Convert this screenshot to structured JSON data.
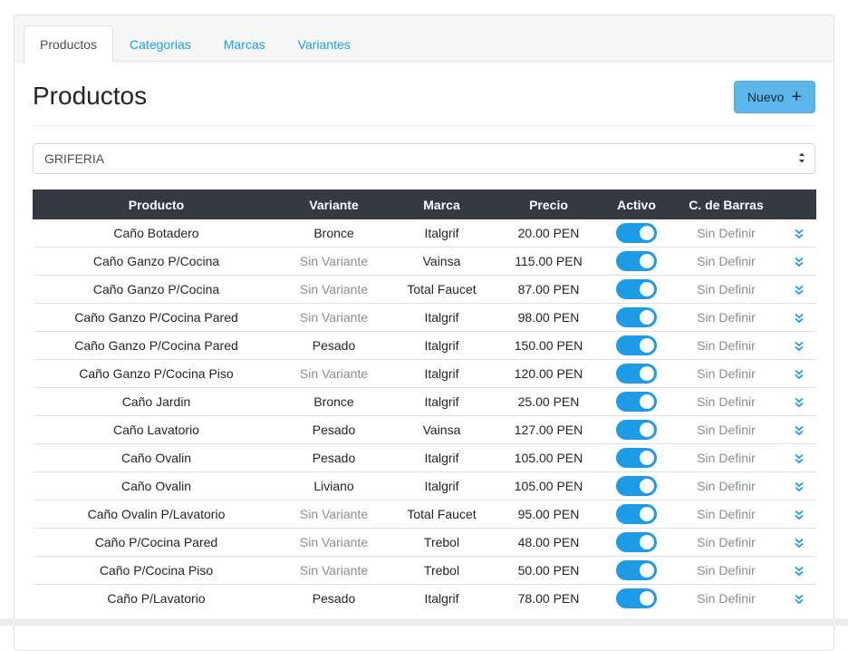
{
  "tabs": [
    {
      "label": "Productos",
      "active": true
    },
    {
      "label": "Categorias",
      "active": false
    },
    {
      "label": "Marcas",
      "active": false
    },
    {
      "label": "Variantes",
      "active": false
    }
  ],
  "page_title": "Productos",
  "new_button": {
    "label": "Nuevo",
    "icon": "plus-icon"
  },
  "category_select": {
    "value": "GRIFERIA"
  },
  "table": {
    "headers": [
      "Producto",
      "Variante",
      "Marca",
      "Precio",
      "Activo",
      "C. de Barras",
      ""
    ],
    "rows": [
      {
        "producto": "Caño Botadero",
        "variante": "Bronce",
        "variante_muted": false,
        "marca": "Italgrif",
        "precio": "20.00 PEN",
        "activo": true,
        "barras": "Sin Definir"
      },
      {
        "producto": "Caño Ganzo P/Cocina",
        "variante": "Sin Variante",
        "variante_muted": true,
        "marca": "Vainsa",
        "precio": "115.00 PEN",
        "activo": true,
        "barras": "Sin Definir"
      },
      {
        "producto": "Caño Ganzo P/Cocina",
        "variante": "Sin Variante",
        "variante_muted": true,
        "marca": "Total Faucet",
        "precio": "87.00 PEN",
        "activo": true,
        "barras": "Sin Definir"
      },
      {
        "producto": "Caño Ganzo P/Cocina Pared",
        "variante": "Sin Variante",
        "variante_muted": true,
        "marca": "Italgrif",
        "precio": "98.00 PEN",
        "activo": true,
        "barras": "Sin Definir"
      },
      {
        "producto": "Caño Ganzo P/Cocina Pared",
        "variante": "Pesado",
        "variante_muted": false,
        "marca": "Italgrif",
        "precio": "150.00 PEN",
        "activo": true,
        "barras": "Sin Definir"
      },
      {
        "producto": "Caño Ganzo P/Cocina Piso",
        "variante": "Sin Variante",
        "variante_muted": true,
        "marca": "Italgrif",
        "precio": "120.00 PEN",
        "activo": true,
        "barras": "Sin Definir"
      },
      {
        "producto": "Caño Jardin",
        "variante": "Bronce",
        "variante_muted": false,
        "marca": "Italgrif",
        "precio": "25.00 PEN",
        "activo": true,
        "barras": "Sin Definir"
      },
      {
        "producto": "Caño Lavatorio",
        "variante": "Pesado",
        "variante_muted": false,
        "marca": "Vainsa",
        "precio": "127.00 PEN",
        "activo": true,
        "barras": "Sin Definir"
      },
      {
        "producto": "Caño Ovalin",
        "variante": "Pesado",
        "variante_muted": false,
        "marca": "Italgrif",
        "precio": "105.00 PEN",
        "activo": true,
        "barras": "Sin Definir"
      },
      {
        "producto": "Caño Ovalin",
        "variante": "Liviano",
        "variante_muted": false,
        "marca": "Italgrif",
        "precio": "105.00 PEN",
        "activo": true,
        "barras": "Sin Definir"
      },
      {
        "producto": "Caño Ovalin P/Lavatorio",
        "variante": "Sin Variante",
        "variante_muted": true,
        "marca": "Total Faucet",
        "precio": "95.00 PEN",
        "activo": true,
        "barras": "Sin Definir"
      },
      {
        "producto": "Caño P/Cocina Pared",
        "variante": "Sin Variante",
        "variante_muted": true,
        "marca": "Trebol",
        "precio": "48.00 PEN",
        "activo": true,
        "barras": "Sin Definir"
      },
      {
        "producto": "Caño P/Cocina Piso",
        "variante": "Sin Variante",
        "variante_muted": true,
        "marca": "Trebol",
        "precio": "50.00 PEN",
        "activo": true,
        "barras": "Sin Definir"
      },
      {
        "producto": "Caño P/Lavatorio",
        "variante": "Pesado",
        "variante_muted": false,
        "marca": "Italgrif",
        "precio": "78.00 PEN",
        "activo": true,
        "barras": "Sin Definir"
      }
    ]
  },
  "colors": {
    "accent": "#1e9be6",
    "header_bg": "#343a40",
    "tab_link": "#1a9fe0",
    "button_bg": "#5bb7ea"
  }
}
